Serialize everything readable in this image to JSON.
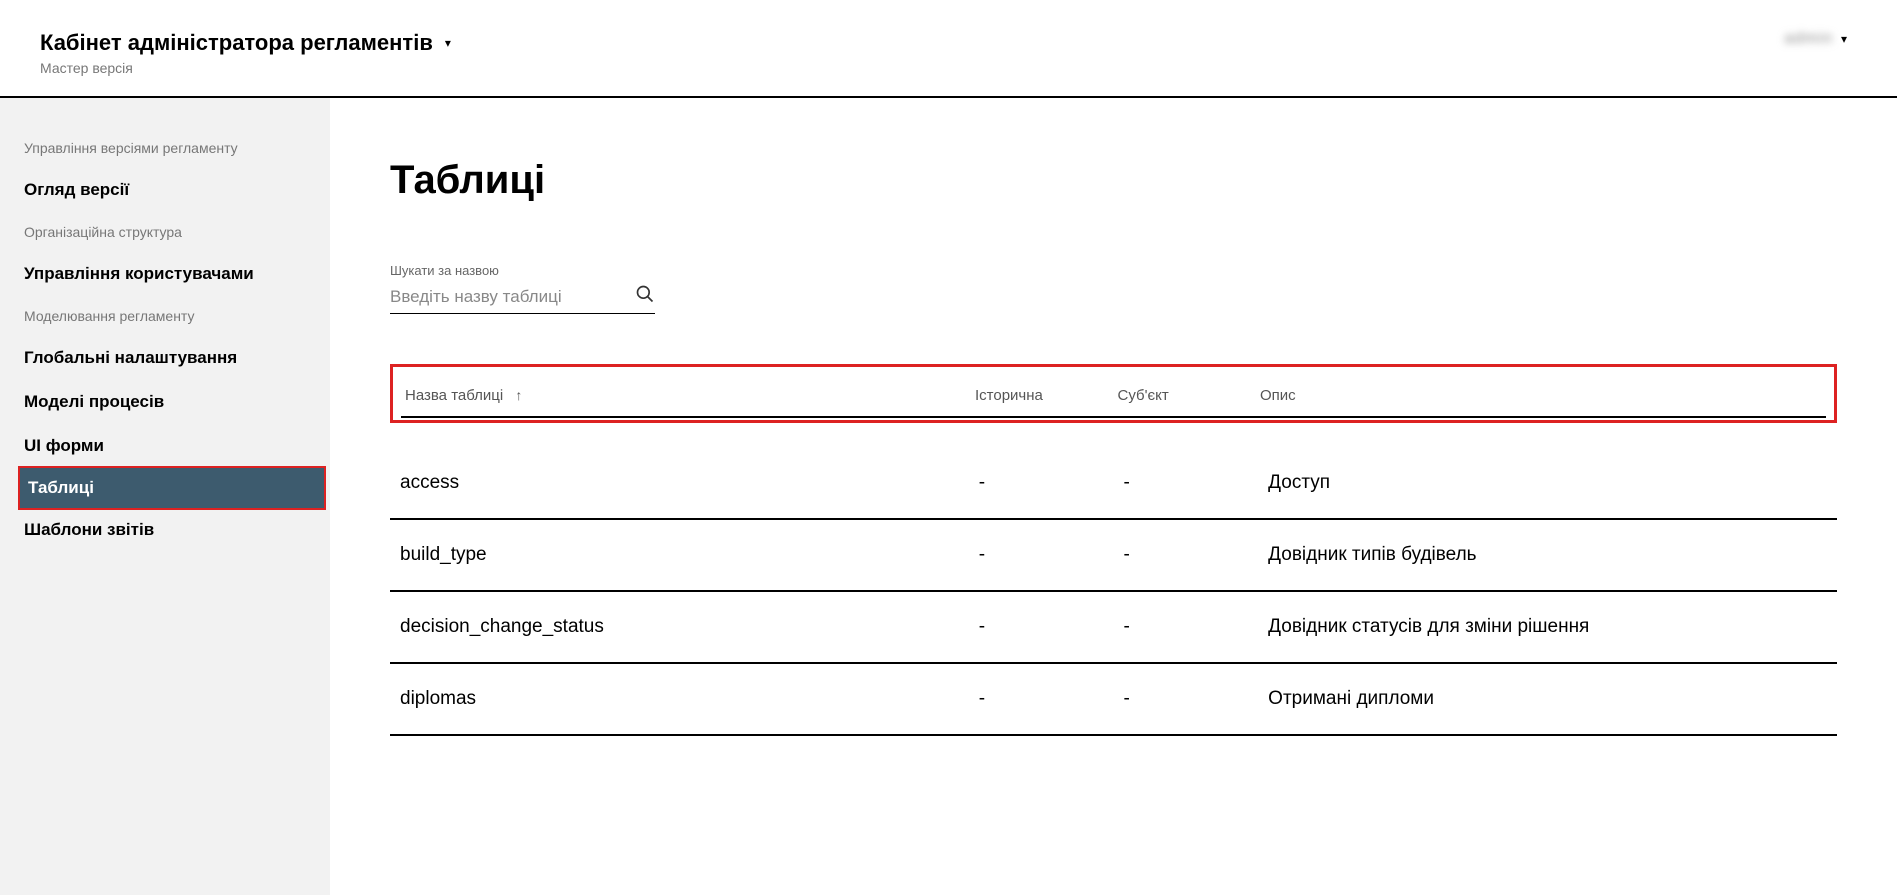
{
  "header": {
    "title": "Кабінет адміністратора регламентів",
    "subtitle": "Мастер версія",
    "user_placeholder": "admin"
  },
  "sidebar": {
    "sections": [
      {
        "label": "Управління версіями регламенту",
        "items": [
          {
            "label": "Огляд версії",
            "active": false
          }
        ]
      },
      {
        "label": "Організаційна структура",
        "items": [
          {
            "label": "Управління користувачами",
            "active": false
          }
        ]
      },
      {
        "label": "Моделювання регламенту",
        "items": [
          {
            "label": "Глобальні налаштування",
            "active": false
          },
          {
            "label": "Моделі процесів",
            "active": false
          },
          {
            "label": "UI форми",
            "active": false
          },
          {
            "label": "Таблиці",
            "active": true
          },
          {
            "label": "Шаблони звітів",
            "active": false
          }
        ]
      }
    ]
  },
  "main": {
    "title": "Таблиці",
    "search": {
      "label": "Шукати за назвою",
      "placeholder": "Введіть назву таблиці"
    },
    "columns": {
      "name": "Назва таблиці",
      "historical": "Історична",
      "subject": "Суб'єкт",
      "description": "Опис"
    },
    "rows": [
      {
        "name": "access",
        "historical": "-",
        "subject": "-",
        "description": "Доступ"
      },
      {
        "name": "build_type",
        "historical": "-",
        "subject": "-",
        "description": "Довідник типів будівель"
      },
      {
        "name": "decision_change_status",
        "historical": "-",
        "subject": "-",
        "description": "Довідник статусів для зміни рішення"
      },
      {
        "name": "diplomas",
        "historical": "-",
        "subject": "-",
        "description": "Отримані дипломи"
      }
    ]
  }
}
